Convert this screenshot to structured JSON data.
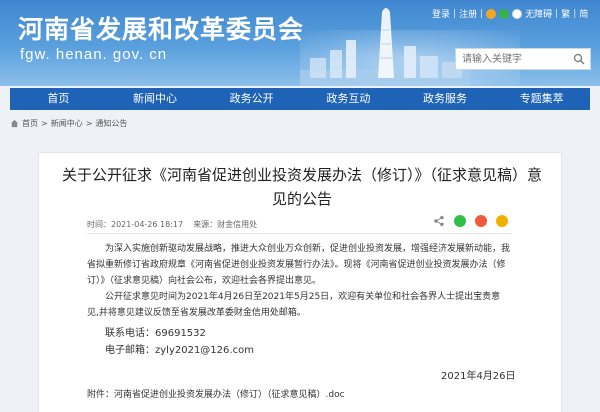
{
  "header": {
    "site_title": "河南省发展和改革委员会",
    "site_url": "fgw. henan. gov. cn",
    "top_links": [
      "登录",
      "注册",
      "无障碍",
      "繁",
      "简"
    ],
    "search_placeholder": "请输入关键字"
  },
  "nav": {
    "items": [
      "首页",
      "新闻中心",
      "政务公开",
      "政务互动",
      "政务服务",
      "专题集萃"
    ]
  },
  "breadcrumb": [
    "首页",
    "新闻中心",
    "通知公告"
  ],
  "article": {
    "title": "关于公开征求《河南省促进创业投资发展办法（修订）》（征求意见稿）意见的公告",
    "time": "时间：2021-04-26 18:17",
    "source": "来源：财金信用处",
    "paragraphs": [
      "为深入实施创新驱动发展战略，推进大众创业万众创新，促进创业投资发展，增强经济发展新动能，我省拟重新修订省政府规章《河南省促进创业投资发展暂行办法》。现将《河南省促进创业投资发展办法（修订）》（征求意见稿）向社会公布，欢迎社会各界提出意见。",
      "公开征求意见时间为2021年4月26日至2021年5月25日，欢迎有关单位和社会各界人士提出宝贵意见,并将意见建议反馈至省发展改革委财金信用处邮箱。"
    ],
    "phone": "联系电话：69691532",
    "email": "电子邮箱：zyly2021@126.com",
    "date": "2021年4月26日",
    "attachment": "附件：河南省促进创业投资发展办法（修订）（征求意见稿）.doc"
  },
  "colors": {
    "nav_bg": "#1f63b6",
    "banner_top": "#3f86cf",
    "page_bg": "#eef1f5"
  }
}
